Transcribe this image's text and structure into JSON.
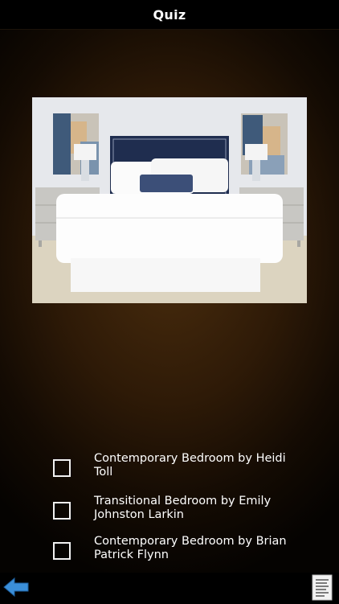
{
  "header": {
    "title": "Quiz"
  },
  "question": {
    "image_alt": "Bedroom with navy headboard, white bedding and silver nightstands"
  },
  "answers": [
    {
      "label": "Contemporary Bedroom by Heidi Toll",
      "checked": false
    },
    {
      "label": "Transitional Bedroom by Emily Johnston Larkin",
      "checked": false
    },
    {
      "label": "Contemporary Bedroom by Brian Patrick Flynn",
      "checked": false
    }
  ],
  "toolbar": {
    "back_icon": "back-arrow-icon",
    "notes_icon": "notes-icon"
  },
  "colors": {
    "background_center": "#4a2d0e",
    "background_edge": "#050301",
    "bar": "#000000",
    "back_arrow": "#3b8fd9",
    "text": "#ffffff"
  }
}
